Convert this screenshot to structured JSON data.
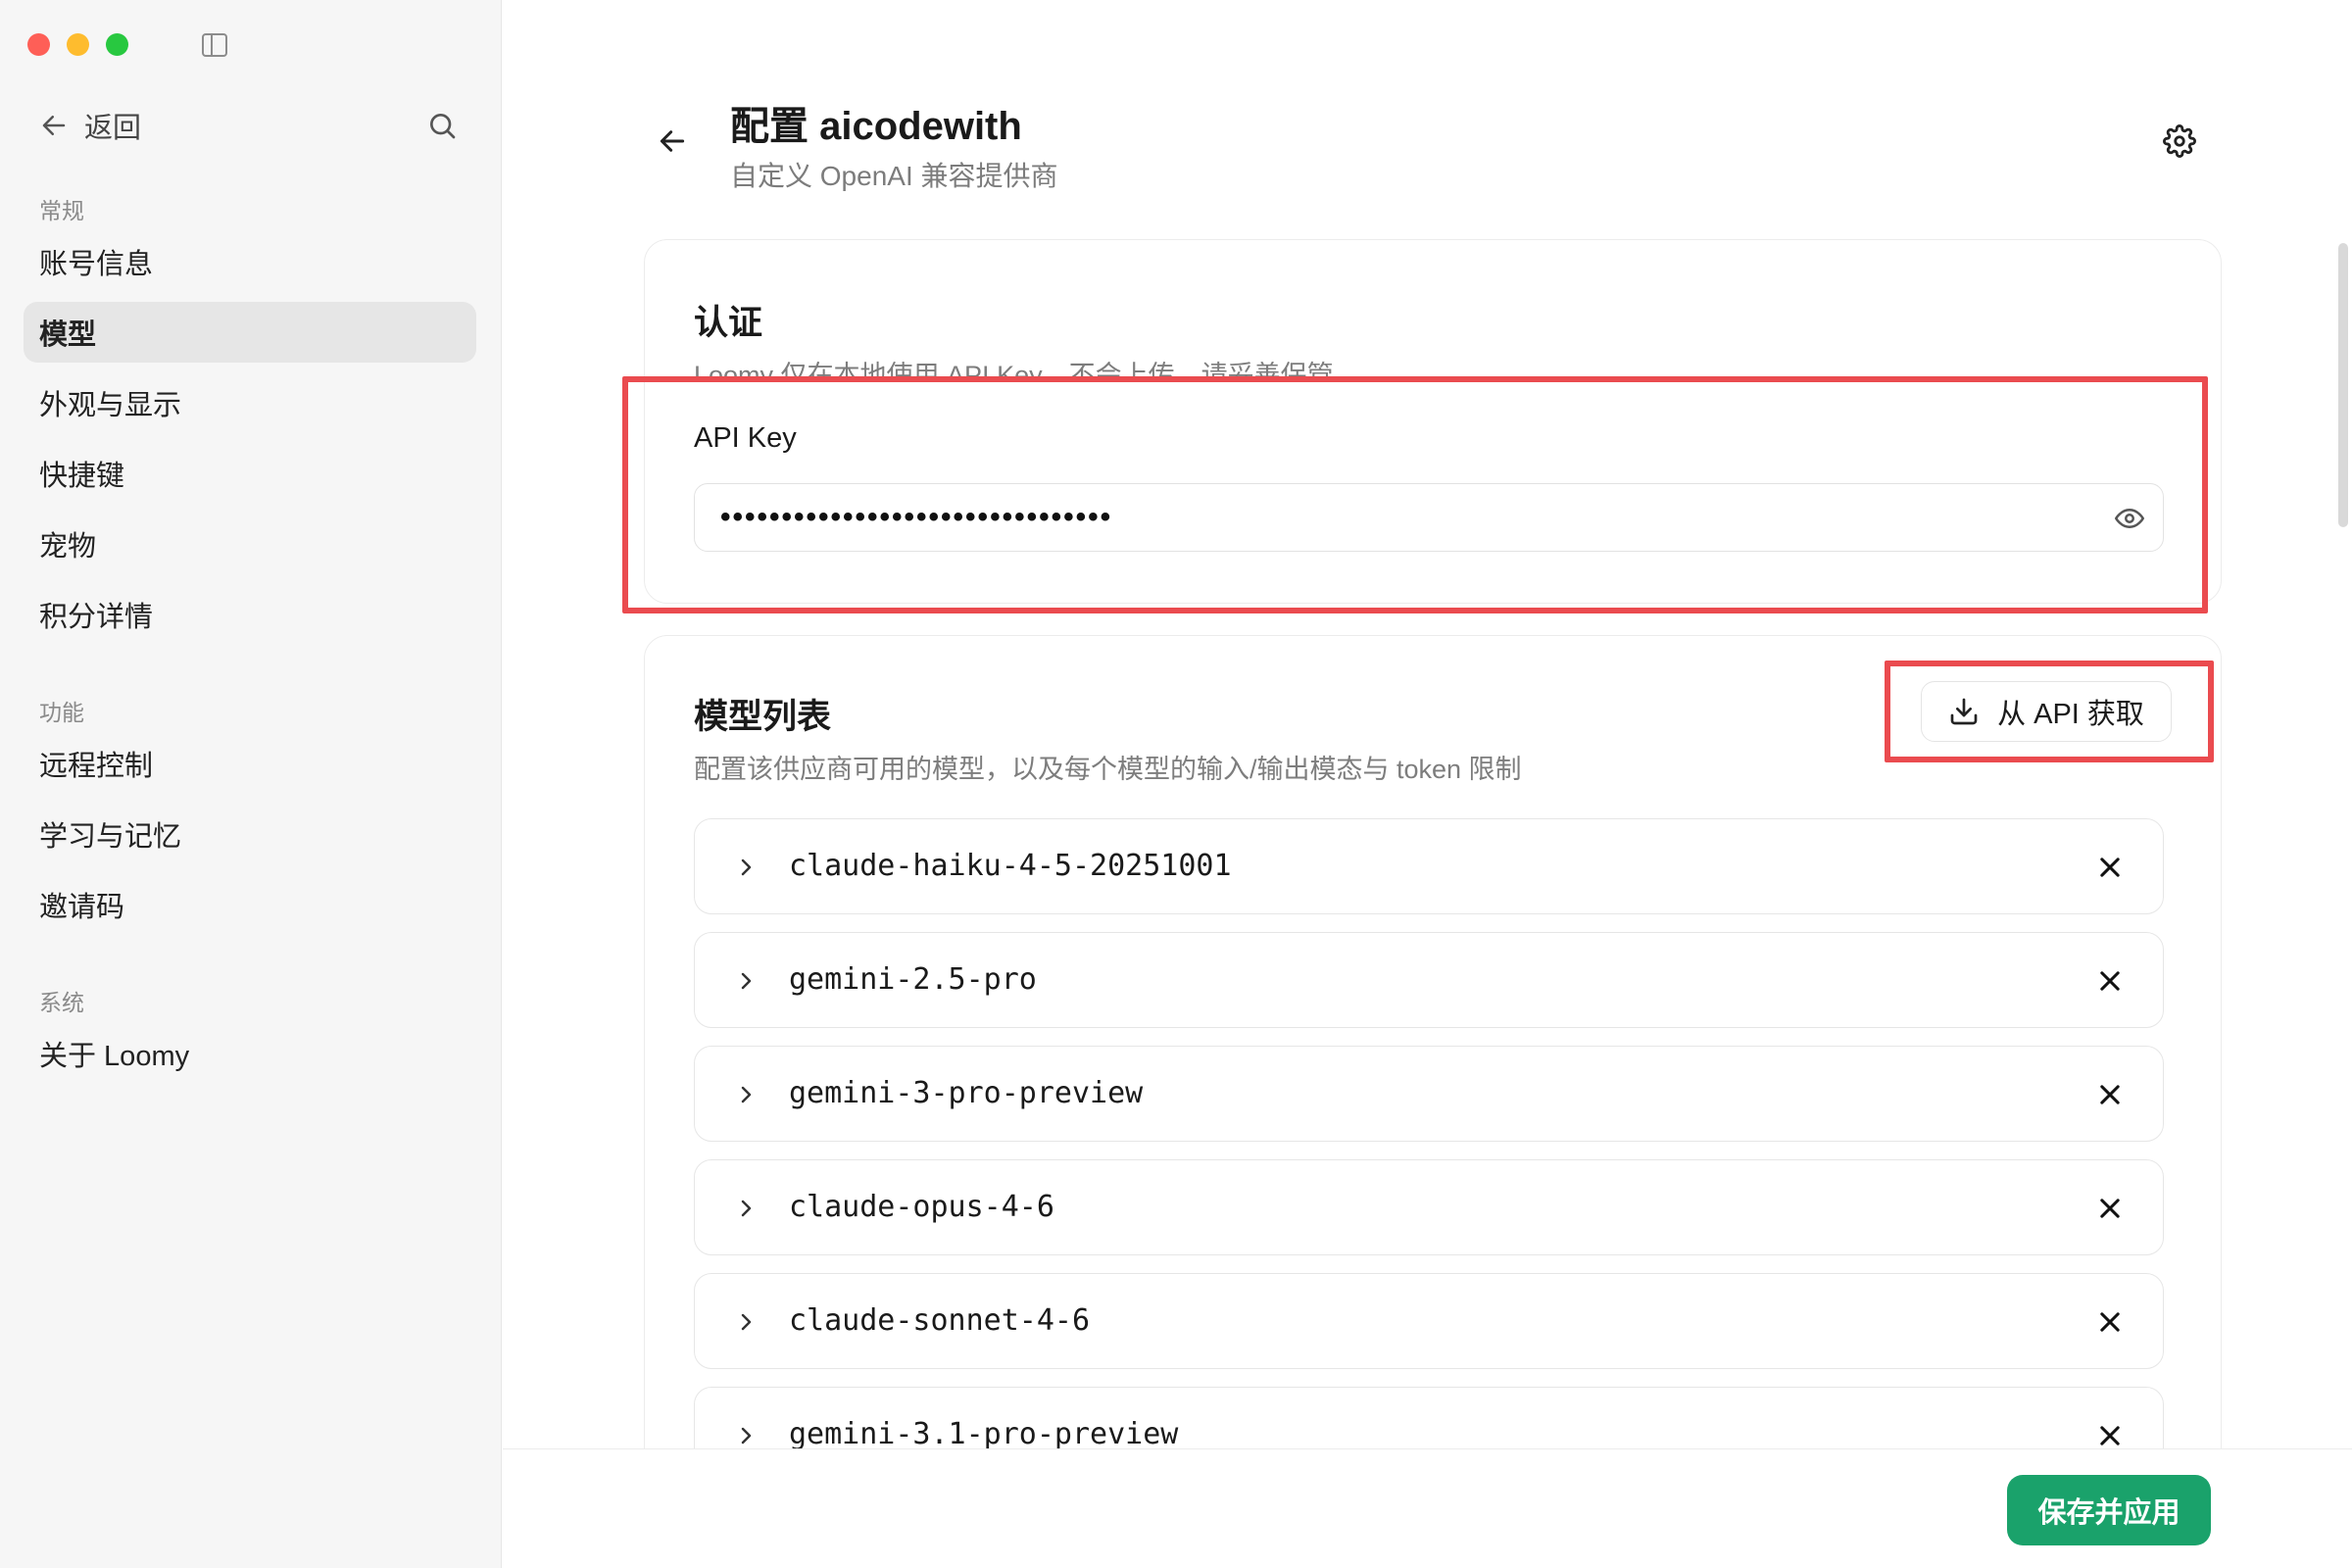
{
  "sidebar": {
    "back_label": "返回",
    "sections": [
      {
        "label": "常规",
        "items": [
          {
            "label": "账号信息"
          },
          {
            "label": "模型",
            "active": true
          },
          {
            "label": "外观与显示"
          },
          {
            "label": "快捷键"
          },
          {
            "label": "宠物"
          },
          {
            "label": "积分详情"
          }
        ]
      },
      {
        "label": "功能",
        "items": [
          {
            "label": "远程控制"
          },
          {
            "label": "学习与记忆"
          },
          {
            "label": "邀请码"
          }
        ]
      },
      {
        "label": "系统",
        "items": [
          {
            "label": "关于 Loomy"
          }
        ]
      }
    ]
  },
  "header": {
    "title": "配置 aicodewith",
    "subtitle": "自定义 OpenAI 兼容提供商"
  },
  "auth": {
    "title": "认证",
    "description": "Loomy 仅在本地使用 API Key，不会上传，请妥善保管",
    "field_label": "API Key",
    "api_key_masked": "••••••••••••••••••••••••••••••••"
  },
  "models": {
    "title": "模型列表",
    "description": "配置该供应商可用的模型，以及每个模型的输入/输出模态与 token 限制",
    "fetch_label": "从 API 获取",
    "items": [
      "claude-haiku-4-5-20251001",
      "gemini-2.5-pro",
      "gemini-3-pro-preview",
      "claude-opus-4-6",
      "claude-sonnet-4-6",
      "gemini-3.1-pro-preview"
    ]
  },
  "footer": {
    "save_label": "保存并应用"
  },
  "colors": {
    "accent": "#1aa26b",
    "highlight": "#ea4b4f",
    "sidebar_bg": "#f6f6f6",
    "active_item_bg": "#e6e6e6"
  },
  "icons": [
    "sidebar-toggle-icon",
    "arrow-left-icon",
    "search-icon",
    "gear-icon",
    "eye-icon",
    "download-icon",
    "chevron-right-icon",
    "close-icon"
  ]
}
